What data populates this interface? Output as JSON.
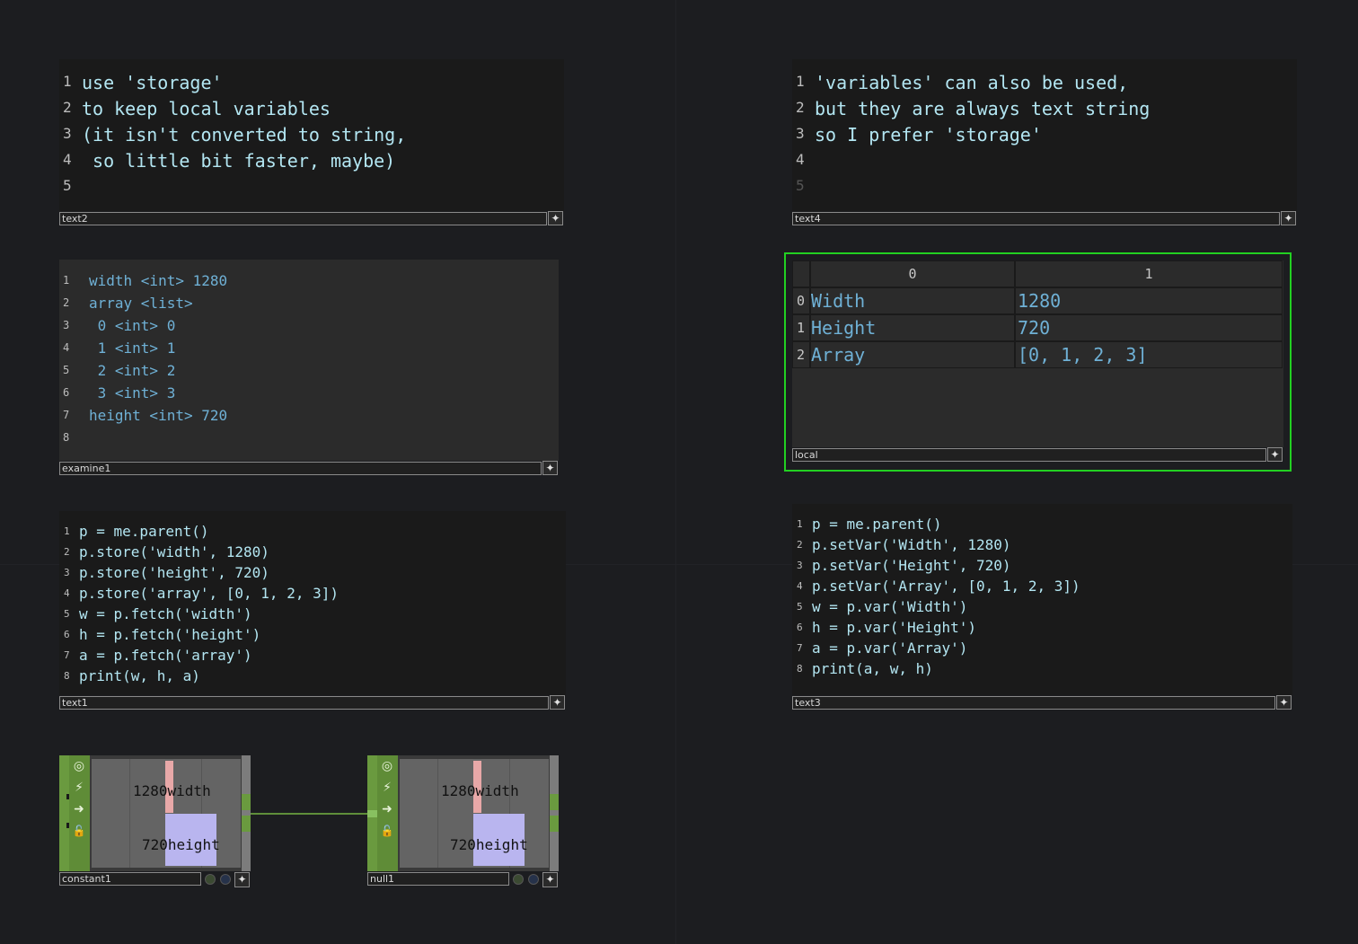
{
  "text2": {
    "name": "text2",
    "line_numbers": [
      "1",
      "2",
      "3",
      "4",
      "5"
    ],
    "lines": [
      "use 'storage'",
      "to keep local variables",
      "(it isn't converted to string,",
      " so little bit faster, maybe)",
      ""
    ]
  },
  "text4": {
    "name": "text4",
    "line_numbers": [
      "1",
      "2",
      "3",
      "4",
      "5"
    ],
    "lines": [
      "'variables' can also be used,",
      "but they are always text string",
      "so I prefer 'storage'",
      "",
      ""
    ]
  },
  "examine1": {
    "name": "examine1",
    "line_numbers": [
      "1",
      "2",
      "3",
      "4",
      "5",
      "6",
      "7",
      "8"
    ],
    "lines": [
      "width <int> 1280",
      "array <list>",
      " 0 <int> 0",
      " 1 <int> 1",
      " 2 <int> 2",
      " 3 <int> 3",
      "height <int> 720",
      ""
    ]
  },
  "local": {
    "name": "local",
    "columns": [
      "0",
      "1"
    ],
    "row_indices": [
      "0",
      "1",
      "2"
    ],
    "rows": [
      [
        "Width",
        "1280"
      ],
      [
        "Height",
        "720"
      ],
      [
        "Array",
        "[0, 1, 2, 3]"
      ]
    ]
  },
  "text1": {
    "name": "text1",
    "line_numbers": [
      "1",
      "2",
      "3",
      "4",
      "5",
      "6",
      "7",
      "8"
    ],
    "lines": [
      "p = me.parent()",
      "p.store('width', 1280)",
      "p.store('height', 720)",
      "p.store('array', [0, 1, 2, 3])",
      "w = p.fetch('width')",
      "h = p.fetch('height')",
      "a = p.fetch('array')",
      "print(w, h, a)"
    ]
  },
  "text3": {
    "name": "text3",
    "line_numbers": [
      "1",
      "2",
      "3",
      "4",
      "5",
      "6",
      "7",
      "8"
    ],
    "lines": [
      "p = me.parent()",
      "p.setVar('Width', 1280)",
      "p.setVar('Height', 720)",
      "p.setVar('Array', [0, 1, 2, 3])",
      "w = p.var('Width')",
      "h = p.var('Height')",
      "a = p.var('Array')",
      "print(a, w, h)"
    ]
  },
  "constant1": {
    "name": "constant1",
    "ch1_value": "1280",
    "ch1_name": "width",
    "ch2_value": "720",
    "ch2_name": "height"
  },
  "null1": {
    "name": "null1",
    "ch1_value": "1280",
    "ch1_name": "width",
    "ch2_value": "720",
    "ch2_name": "height"
  },
  "colors": {
    "background": "#1c1d20",
    "selection": "#22d022",
    "node_green": "#6a9a3f",
    "text": "#b3e6f2",
    "table_text": "#6fb1d6"
  },
  "icons": {
    "expand": "plus-sparkle-icon",
    "viewer": "eye-icon",
    "export": "graph-icon",
    "bypass": "arrow-icon",
    "lock": "lock-icon"
  },
  "glyphs": {
    "plus": "✦",
    "viewer": "◎",
    "export": "⚡",
    "bypass": "➜",
    "lock": "🔓"
  }
}
